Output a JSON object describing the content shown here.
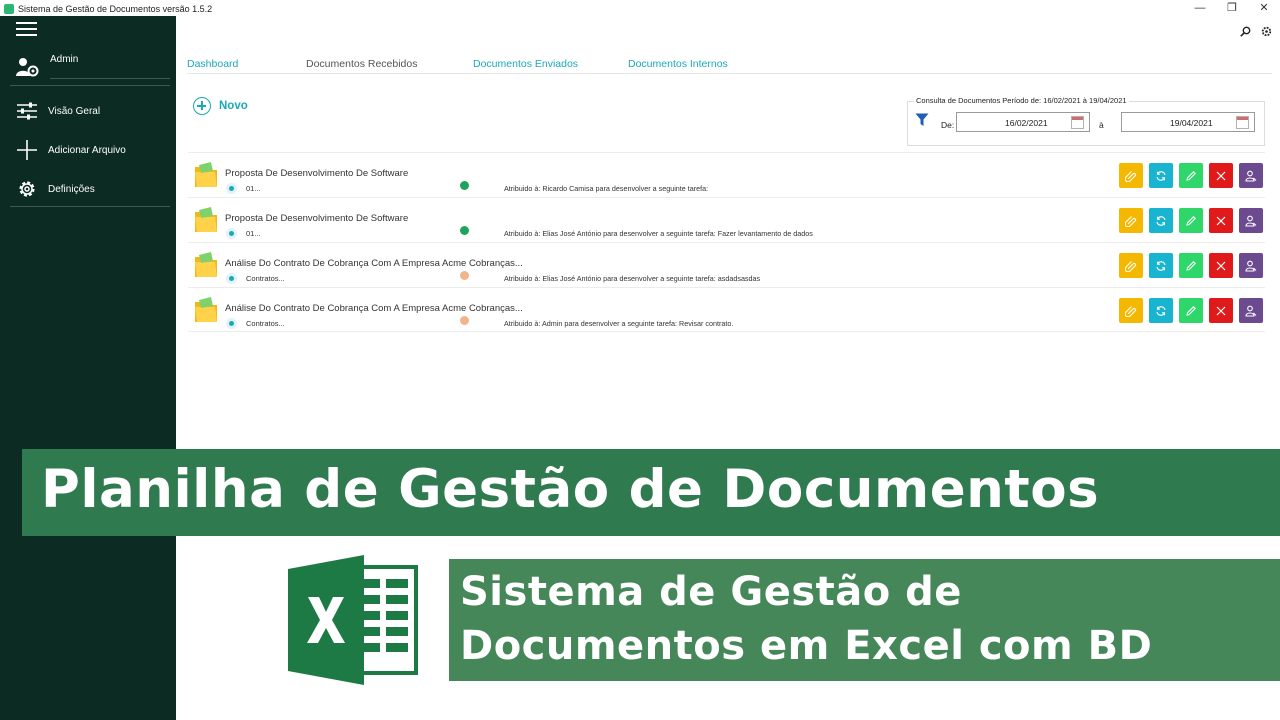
{
  "window": {
    "title": "Sistema de Gestão de Documentos versão 1.5.2",
    "controls": {
      "minimize": "—",
      "maximize": "❐",
      "close": "✕"
    }
  },
  "sidebar": {
    "user": "Admin",
    "items": [
      {
        "label": "Visão Geral",
        "icon": "sliders-icon"
      },
      {
        "label": "Adicionar Arquivo",
        "icon": "plus-icon"
      },
      {
        "label": "Definições",
        "icon": "gear-icon"
      }
    ]
  },
  "tabs": [
    {
      "label": "Dashboard",
      "state": "active"
    },
    {
      "label": "Documentos Recebidos",
      "state": "muted"
    },
    {
      "label": "Documentos Enviados",
      "state": "link"
    },
    {
      "label": "Documentos Internos",
      "state": "link"
    }
  ],
  "toolbar": {
    "new_label": "Novo"
  },
  "period": {
    "title": "Consulta de Documentos Período de: 16/02/2021 à 19/04/2021",
    "from_label": "De:",
    "from_value": "16/02/2021",
    "to_label": "à",
    "to_value": "19/04/2021"
  },
  "documents": [
    {
      "title": "Proposta De Desenvolvimento De Software",
      "sub": "01...",
      "status_color": "#1ea35a",
      "assignment": "Atribuido à: Ricardo Camisa para desenvolver a seguinte tarefa:"
    },
    {
      "title": "Proposta De Desenvolvimento De Software",
      "sub": "01...",
      "status_color": "#1ea35a",
      "assignment": "Atribuido à: Elias José António para desenvolver a seguinte tarefa: Fazer levantamento de dados"
    },
    {
      "title": "Análise Do Contrato De Cobrança Com A Empresa Acme Cobranças...",
      "sub": "Contratos...",
      "status_color": "#f0b58a",
      "assignment": "Atribuido à: Elias José António para desenvolver a seguinte tarefa: asdadsasdas"
    },
    {
      "title": "Análise Do Contrato De Cobrança Com A Empresa Acme Cobranças...",
      "sub": "Contratos...",
      "status_color": "#f0b58a",
      "assignment": "Atribuido à: Admin para desenvolver a seguinte tarefa: Revisar contrato."
    }
  ],
  "action_colors": {
    "attach": "#f5b800",
    "sync": "#19b5d0",
    "edit": "#2fd66a",
    "delete": "#e01a1a",
    "assign": "#6b4a8f"
  },
  "banners": {
    "main": "Planilha de Gestão de Documentos",
    "line1": "Sistema de Gestão de",
    "line2": "Documentos em Excel com BD"
  },
  "colors": {
    "sidebar_bg": "#0c2b22",
    "accent": "#1aa9b8",
    "banner_main": "#2f7a4e",
    "banner_sub": "#46875a",
    "excel_green": "#1e7a45"
  }
}
